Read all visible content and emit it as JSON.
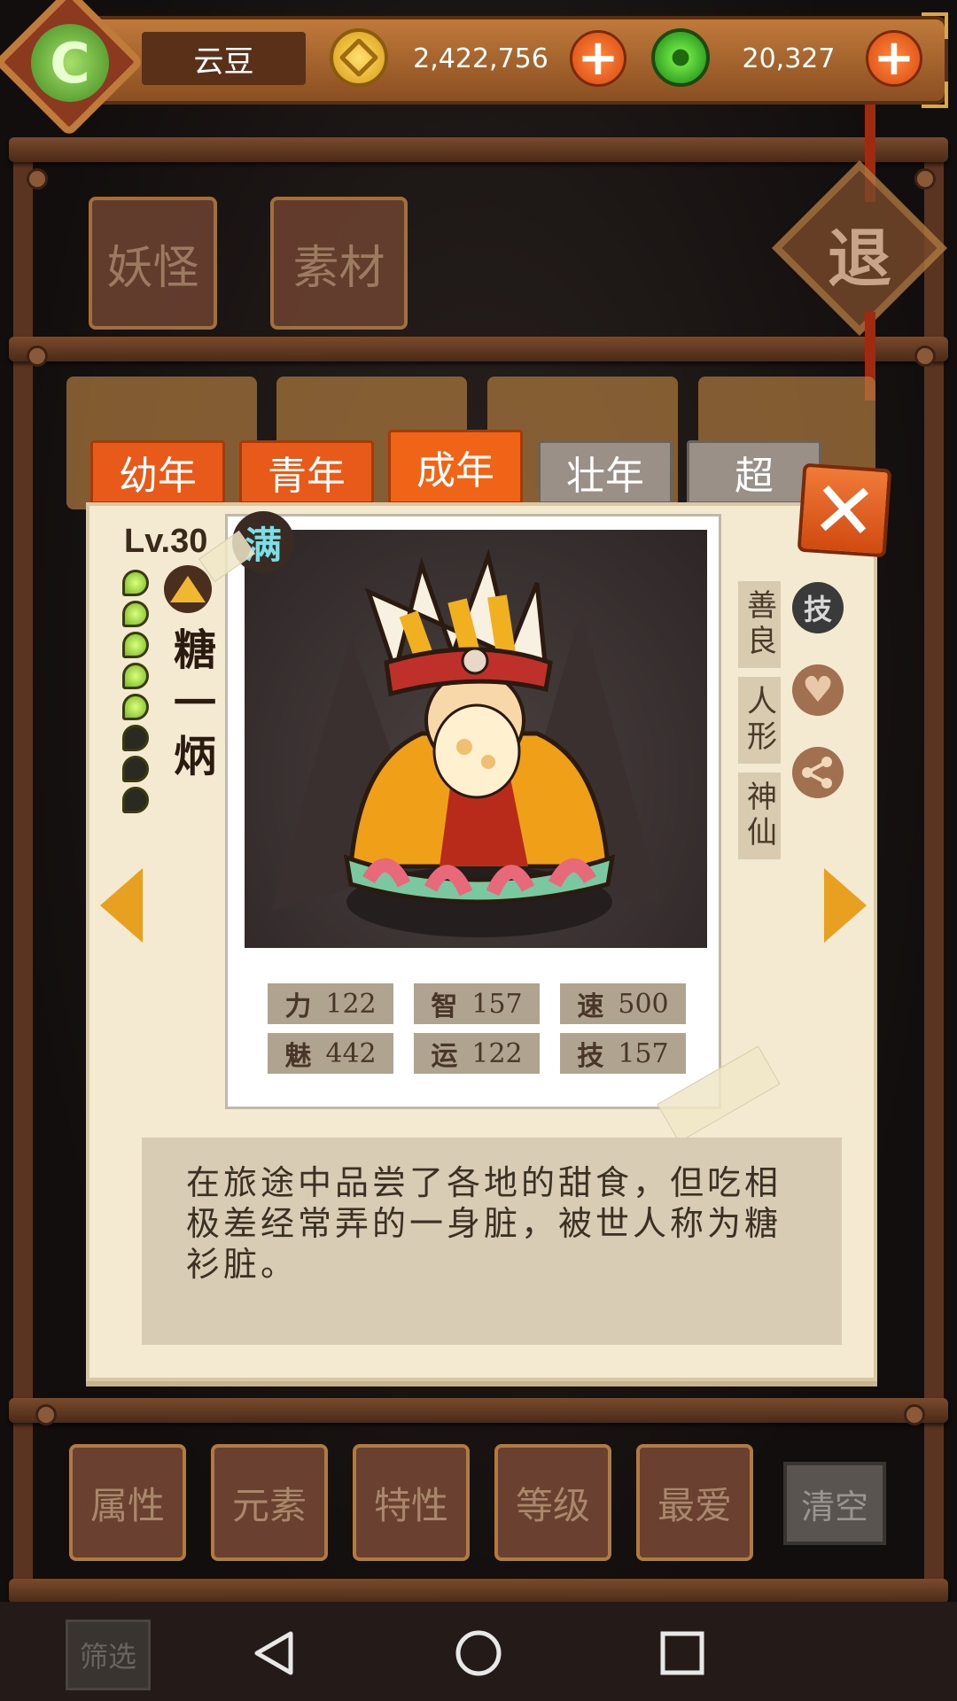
{
  "player": {
    "name": "云豆"
  },
  "currency": {
    "coins": "2,422,756",
    "jade": "20,327"
  },
  "categories": [
    "妖怪",
    "素材"
  ],
  "exit_label": "退",
  "age_tabs": [
    {
      "label": "幼年",
      "state": "available"
    },
    {
      "label": "青年",
      "state": "available"
    },
    {
      "label": "成年",
      "state": "selected"
    },
    {
      "label": "壮年",
      "state": "locked"
    },
    {
      "label": "超",
      "state": "locked"
    }
  ],
  "character": {
    "level": "Lv.30",
    "max_badge": "满",
    "name": "糖一炳",
    "beads_filled": 5,
    "beads_total": 8,
    "element_icon": "mountain-icon",
    "traits": [
      "善良",
      "人形",
      "神仙"
    ],
    "stats": [
      {
        "key": "力",
        "value": "122"
      },
      {
        "key": "智",
        "value": "157"
      },
      {
        "key": "速",
        "value": "500"
      },
      {
        "key": "魅",
        "value": "442"
      },
      {
        "key": "运",
        "value": "122"
      },
      {
        "key": "技",
        "value": "157"
      }
    ],
    "skill_icon_label": "技",
    "description": "在旅途中品尝了各地的甜食，但吃相极差经常弄的一身脏，被世人称为糖衫脏。"
  },
  "filters": [
    "属性",
    "元素",
    "特性",
    "等级",
    "最爱"
  ],
  "clear_label": "清空",
  "screen_label": "筛选",
  "colors": {
    "accent": "#e85a1a",
    "panel": "#f4ead2",
    "wood": "#6a4030"
  }
}
